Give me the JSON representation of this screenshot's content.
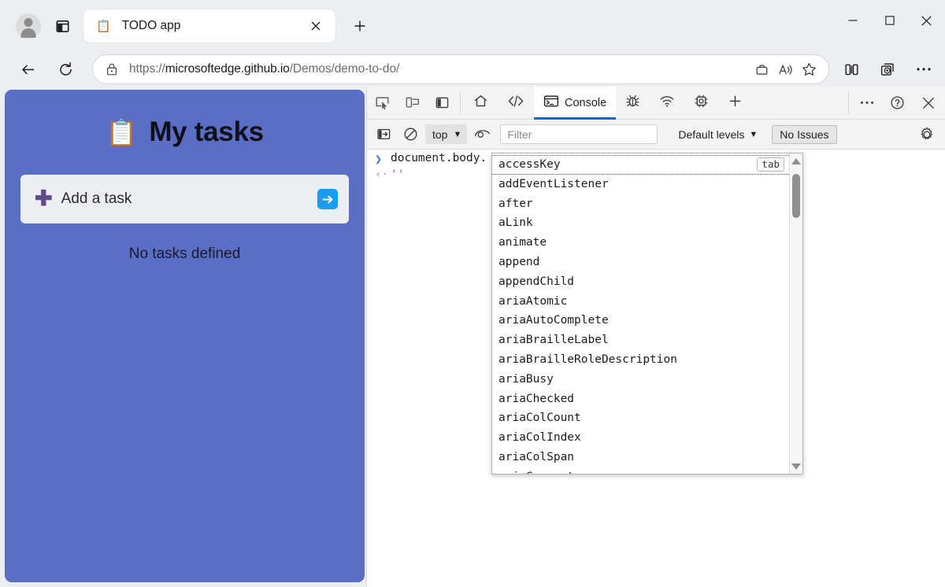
{
  "browser": {
    "avatar_label": "profile-avatar",
    "tab_search_icon": "tab-list-icon",
    "tabs": [
      {
        "favicon": "📋",
        "title": "TODO app",
        "close_label": "✕"
      }
    ],
    "new_tab_label": "+",
    "window_controls": {
      "minimize": "—",
      "maximize": "□",
      "close": "✕"
    },
    "nav": {
      "back_label": "←",
      "reload_label": "⟳"
    },
    "omnibox": {
      "lock_icon": "lock-icon",
      "url_scheme": "https://",
      "url_host": "microsoftedge.github.io",
      "url_path": "/Demos/demo-to-do/",
      "actions": [
        "briefcase-icon",
        "read-aloud-icon",
        "favorite-star-icon"
      ]
    },
    "toolbar_right": [
      "split-screen-icon",
      "collections-icon",
      "settings-more-icon"
    ]
  },
  "page": {
    "heading_icon": "📋",
    "heading": "My tasks",
    "add_task": {
      "plus": "✚",
      "placeholder": "Add a task",
      "submit_icon": "arrow-right-icon"
    },
    "empty_message": "No tasks defined"
  },
  "devtools": {
    "left_icons": [
      "inspect-element-icon",
      "device-emulation-icon",
      "dock-side-icon"
    ],
    "tabs": [
      {
        "id": "welcome",
        "icon": "home-icon",
        "label": "",
        "active": false
      },
      {
        "id": "elements",
        "icon": "code-icon",
        "label": "",
        "active": false
      },
      {
        "id": "console",
        "icon": "console-icon",
        "label": "Console",
        "active": true
      },
      {
        "id": "sources",
        "icon": "bug-icon",
        "label": "",
        "active": false
      },
      {
        "id": "network",
        "icon": "network-icon",
        "label": "",
        "active": false
      },
      {
        "id": "performance",
        "icon": "chip-icon",
        "label": "",
        "active": false
      },
      {
        "id": "more-tools",
        "icon": "plus-icon",
        "label": "",
        "active": false
      }
    ],
    "tab_right_icons": [
      "more-options-icon",
      "help-icon",
      "close-devtools-icon"
    ],
    "filterbar": {
      "sidebar_toggle_icon": "console-sidebar-icon",
      "clear_icon": "clear-console-icon",
      "context": "top",
      "context_chevron": "▼",
      "live_expression_icon": "eye-icon",
      "filter_placeholder": "Filter",
      "levels_label": "Default levels",
      "levels_chevron": "▼",
      "issues_label": "No Issues",
      "settings_icon": "gear-icon"
    },
    "console": {
      "prompt_caret": "❯",
      "prompt_text": "document.body.",
      "result_caret": "‹·",
      "result_value": "''"
    },
    "autocomplete": {
      "selected_badge": "tab",
      "items": [
        "accessKey",
        "addEventListener",
        "after",
        "aLink",
        "animate",
        "append",
        "appendChild",
        "ariaAtomic",
        "ariaAutoComplete",
        "ariaBrailleLabel",
        "ariaBrailleRoleDescription",
        "ariaBusy",
        "ariaChecked",
        "ariaColCount",
        "ariaColIndex",
        "ariaColSpan",
        "ariaCurrent"
      ],
      "selected_index": 0,
      "scroll_up_icon": "scroll-up-arrow",
      "scroll_down_icon": "scroll-down-arrow"
    }
  },
  "colors": {
    "todo_panel": "#5b6ec5",
    "accent_blue": "#1a9cf0",
    "devtools_active_underline": "#1668c9",
    "chrome_bg": "#eceef1"
  }
}
